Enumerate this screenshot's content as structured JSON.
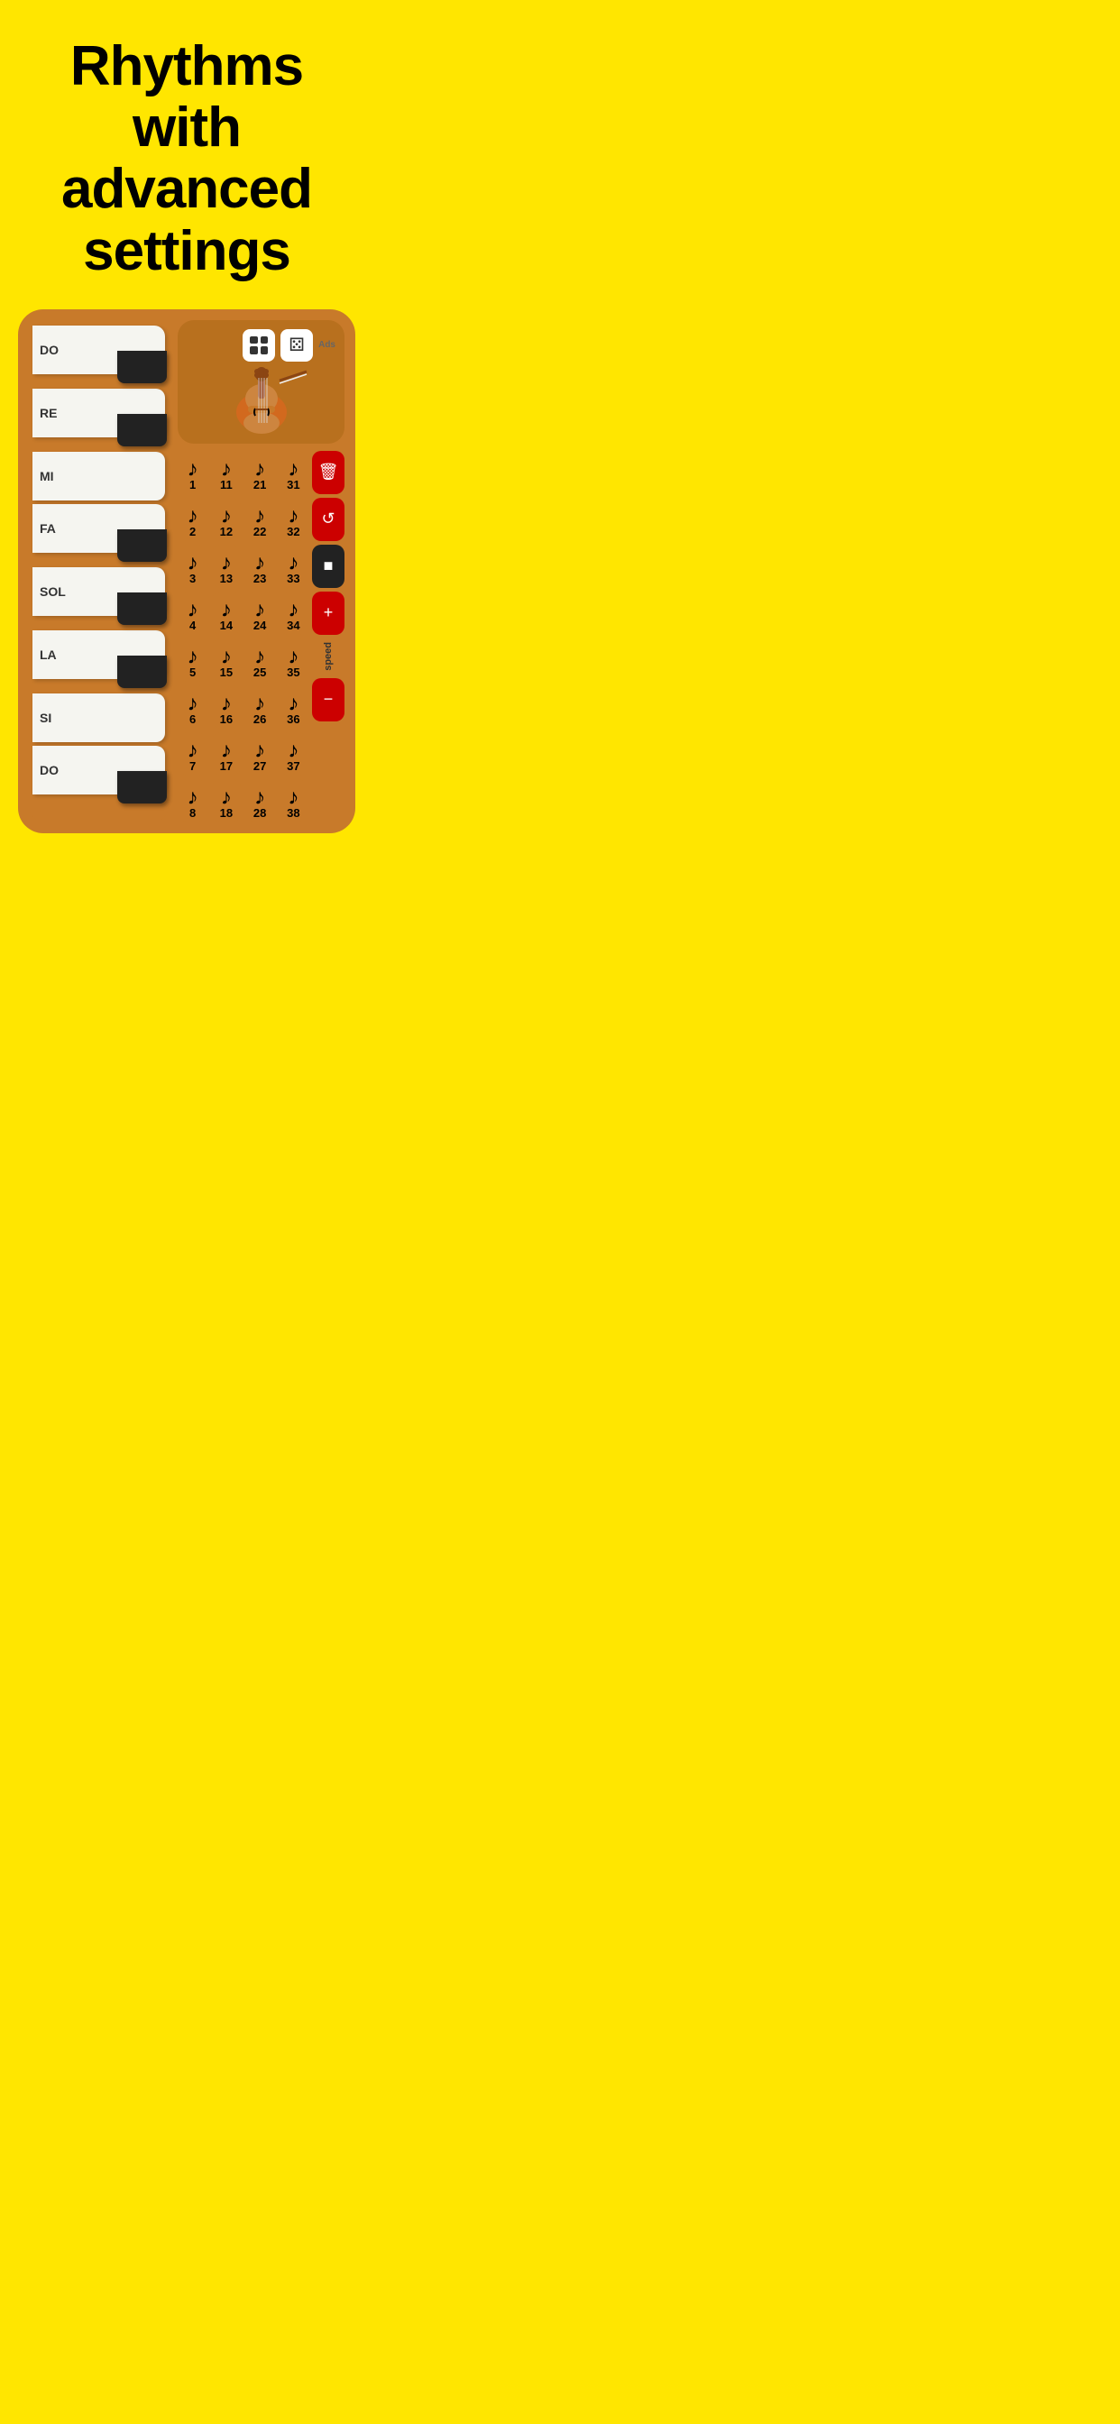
{
  "header": {
    "line1": "Rhythms",
    "line2": "with",
    "line3": "advanced",
    "line4": "settings"
  },
  "piano": {
    "keys": [
      {
        "label": "DO",
        "hasBlack": true
      },
      {
        "label": "RE",
        "hasBlack": true
      },
      {
        "label": "MI",
        "hasBlack": false
      },
      {
        "label": "FA",
        "hasBlack": true
      },
      {
        "label": "SOL",
        "hasBlack": true
      },
      {
        "label": "LA",
        "hasBlack": true
      },
      {
        "label": "SI",
        "hasBlack": false
      },
      {
        "label": "DO",
        "hasBlack": true
      }
    ]
  },
  "rhythm": {
    "icons": {
      "grid": "⊞",
      "dice": "⚄",
      "ads": "Ads"
    },
    "grid": [
      [
        "31",
        "21",
        "11",
        "1"
      ],
      [
        "32",
        "22",
        "12",
        "2"
      ],
      [
        "33",
        "23",
        "13",
        "3"
      ],
      [
        "34",
        "24",
        "14",
        "4"
      ],
      [
        "35",
        "25",
        "15",
        "5"
      ],
      [
        "36",
        "26",
        "16",
        "6"
      ],
      [
        "37",
        "27",
        "17",
        "7"
      ],
      [
        "38",
        "28",
        "18",
        "8"
      ]
    ],
    "controls": {
      "delete_label": "🗑",
      "loop_label": "↺",
      "stop_label": "■",
      "plus_label": "+",
      "speed_label": "speed",
      "minus_label": "−"
    }
  }
}
